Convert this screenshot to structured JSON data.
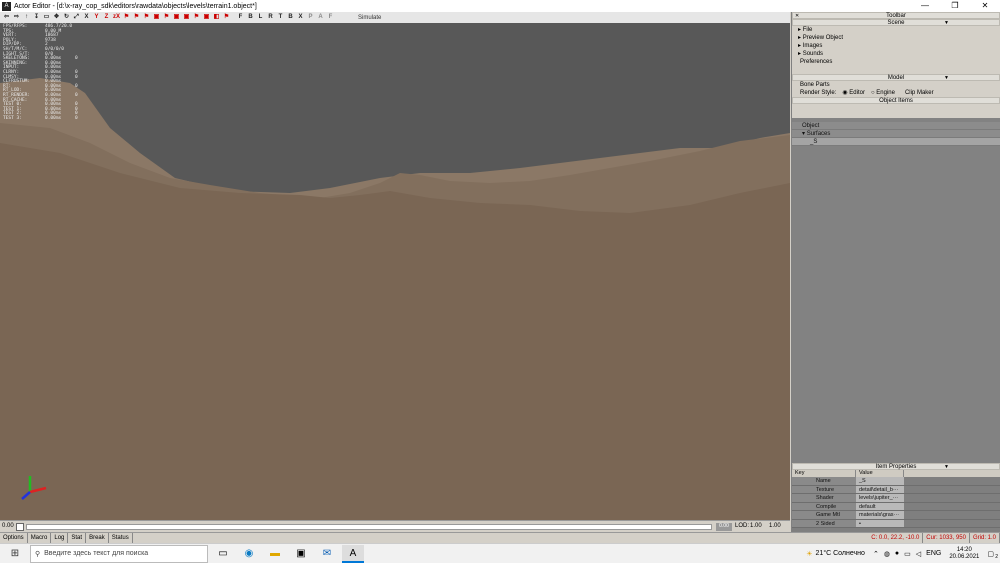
{
  "window": {
    "app_icon": "A",
    "title": "Actor Editor - [d:\\x-ray_cop_sdk\\editors\\rawdata\\objects\\levels\\terrain1.object*]",
    "minimize": "—",
    "maximize": "❐",
    "close": "✕"
  },
  "toolbar": {
    "buttons": [
      "⇦",
      "⇨",
      "↑",
      "↧",
      "▭",
      "✥",
      "↻",
      "⤢",
      "X",
      "Y",
      "Z",
      "zX",
      "⚑",
      "⚑",
      "⚑",
      "▣",
      "⚑",
      "▣",
      "▣",
      "⚑",
      "▣",
      "◧",
      "⚑"
    ],
    "letters": [
      "F",
      "B",
      "L",
      "R",
      "T",
      "B",
      "X",
      "P",
      "A",
      "F"
    ],
    "simulate": "Simulate"
  },
  "stats": [
    [
      "FPS/RFPS:",
      "486.7/20.0"
    ],
    [
      "TPS:",
      "0.00 M"
    ],
    [
      "VERT:",
      "18687"
    ],
    [
      "POLY:",
      "9738"
    ],
    [
      "DIP/DP:",
      "2"
    ],
    [
      "SH/T/M/C:",
      "0/0/0/0"
    ],
    [
      "LIGHT S/T:",
      "0/0"
    ],
    [
      "SKELETONS:",
      "0.00ms",
      "0"
    ],
    [
      "SKINNING:",
      "0.00ms"
    ],
    [
      "",
      ""
    ],
    [
      "INPUT:",
      "0.00ms"
    ],
    [
      "CLRNY:",
      "0.00ms",
      "0"
    ],
    [
      "CLMSY:",
      "0.00ms",
      "0"
    ],
    [
      "CLFRUSTUM:",
      "0.00ms"
    ],
    [
      "",
      ""
    ],
    [
      "RT:",
      "0.00ms",
      "0"
    ],
    [
      "RT_LOD:",
      "0.00ms"
    ],
    [
      "RT_RENDER:",
      "0.00ms",
      "0"
    ],
    [
      "RT_CACHE:",
      "0.00ms"
    ],
    [
      "",
      ""
    ],
    [
      "TEST 0:",
      "0.00ms",
      "0"
    ],
    [
      "TEST 1:",
      "0.00ms",
      "0"
    ],
    [
      "TEST 2:",
      "0.00ms",
      "0"
    ],
    [
      "TEST 3:",
      "0.00ms",
      "0"
    ]
  ],
  "panel": {
    "toolbar_header": "Toolbar",
    "scene_header": "Scene",
    "scene_items": [
      "File",
      "Preview Object",
      "Images",
      "Sounds",
      "Preferences"
    ],
    "model_header": "Model",
    "bone_parts": "Bone Parts",
    "render_style_label": "Render Style:",
    "render_editor": "Editor",
    "render_engine": "Engine",
    "clip_maker": "Clip Maker",
    "object_items_header": "Object Items",
    "object_items": [
      "Object",
      "Surfaces",
      "_S"
    ],
    "item_props_header": "Item Properties",
    "props_col_key": "Key",
    "props_col_value": "Value",
    "props": [
      {
        "k": "Name",
        "v": "_S"
      },
      {
        "k": "Texture",
        "v": "detail\\detail_b···"
      },
      {
        "k": "Shader",
        "v": "levels\\jupiter_···"
      },
      {
        "k": "Compile",
        "v": "default"
      },
      {
        "k": "Game Mtl",
        "v": "materials\\gras···"
      },
      {
        "k": "2 Sided",
        "v": "•"
      }
    ]
  },
  "progress": {
    "time": "0.00",
    "lod_label": "LOD:",
    "lod_value": "1.00",
    "value2": "1.00",
    "right_value": "0.00"
  },
  "statusbar": {
    "options": "Options",
    "macro": "Macro",
    "log": "Log",
    "stat": "Stat",
    "break": "Break",
    "status": "Status",
    "coords": "C: 0.0, 22.2, -10.0",
    "cursor": "Cur: 1033, 950",
    "grid": "Grid: 1.0"
  },
  "taskbar": {
    "search_placeholder": "Введите здесь текст для поиска",
    "weather": "21°C Солнечно",
    "lang": "ENG",
    "time": "14:20",
    "date": "20.06.2021",
    "notif_count": "2"
  },
  "colors": {
    "sky": "#585858",
    "ground": "#7d6a58",
    "accent_red": "#c00000"
  }
}
